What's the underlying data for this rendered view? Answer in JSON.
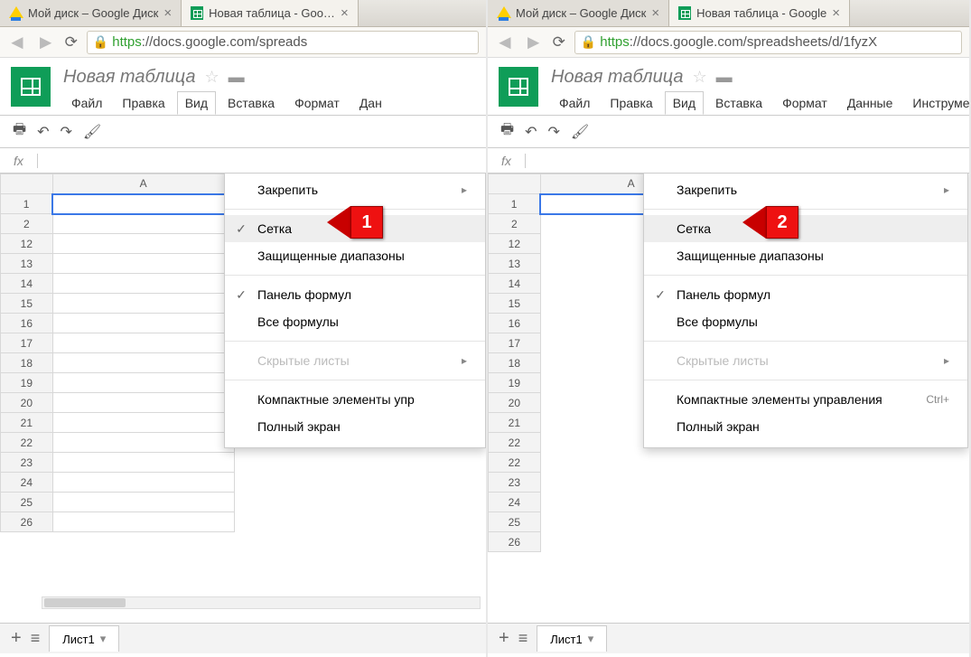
{
  "left": {
    "tabs": [
      {
        "label": "Мой диск – Google Диск",
        "active": false
      },
      {
        "label": "Новая таблица - Goo…",
        "active": true
      }
    ],
    "url_https": "https",
    "url_rest": "://docs.google.com/spreads",
    "doc_title": "Новая таблица",
    "menus": [
      "Файл",
      "Правка",
      "Вид",
      "Вставка",
      "Формат",
      "Дан"
    ],
    "open_menu_index": 2,
    "fx": "fx",
    "col_headers": [
      "A"
    ],
    "rows_first": [
      "1",
      "2"
    ],
    "rows_rest": [
      "12",
      "13",
      "14",
      "15",
      "16",
      "17",
      "18",
      "19",
      "20",
      "21",
      "22",
      "23",
      "24",
      "25",
      "26"
    ],
    "dropdown": [
      {
        "label": "Закрепить",
        "kind": "item",
        "arrow": true
      },
      {
        "kind": "sep"
      },
      {
        "label": "Сетка",
        "kind": "item",
        "checked": true,
        "hl": true
      },
      {
        "label": "Защищенные диапазоны",
        "kind": "item"
      },
      {
        "kind": "sep"
      },
      {
        "label": "Панель формул",
        "kind": "item",
        "checked": true
      },
      {
        "label": "Все формулы",
        "kind": "item"
      },
      {
        "kind": "sep"
      },
      {
        "label": "Скрытые листы",
        "kind": "item",
        "disabled": true,
        "arrow": true
      },
      {
        "kind": "sep"
      },
      {
        "label": "Компактные элементы упр",
        "kind": "item"
      },
      {
        "label": "Полный экран",
        "kind": "item"
      }
    ],
    "callout_number": "1",
    "sheet_tab": "Лист1"
  },
  "right": {
    "tabs": [
      {
        "label": "Мой диск – Google Диск",
        "active": false
      },
      {
        "label": "Новая таблица - Google",
        "active": true
      }
    ],
    "url_https": "https",
    "url_rest": "://docs.google.com/spreadsheets/d/1fyzX",
    "doc_title": "Новая таблица",
    "menus": [
      "Файл",
      "Правка",
      "Вид",
      "Вставка",
      "Формат",
      "Данные",
      "Инструме"
    ],
    "open_menu_index": 2,
    "fx": "fx",
    "col_headers": [
      "A"
    ],
    "rows_first": [
      "1",
      "2"
    ],
    "rows_rest": [
      "12",
      "13",
      "14",
      "15",
      "16",
      "17",
      "18",
      "19",
      "20",
      "21",
      "22",
      "22",
      "23",
      "24",
      "25",
      "26"
    ],
    "dropdown": [
      {
        "label": "Закрепить",
        "kind": "item",
        "arrow": true
      },
      {
        "kind": "sep"
      },
      {
        "label": "Сетка",
        "kind": "item",
        "hl": true
      },
      {
        "label": "Защищенные диапазоны",
        "kind": "item"
      },
      {
        "kind": "sep"
      },
      {
        "label": "Панель формул",
        "kind": "item",
        "checked": true
      },
      {
        "label": "Все формулы",
        "kind": "item"
      },
      {
        "kind": "sep"
      },
      {
        "label": "Скрытые листы",
        "kind": "item",
        "disabled": true,
        "arrow": true
      },
      {
        "kind": "sep"
      },
      {
        "label": "Компактные элементы управления",
        "kind": "item",
        "kbd": "Ctrl+"
      },
      {
        "label": "Полный экран",
        "kind": "item"
      }
    ],
    "callout_number": "2",
    "sheet_tab": "Лист1"
  }
}
